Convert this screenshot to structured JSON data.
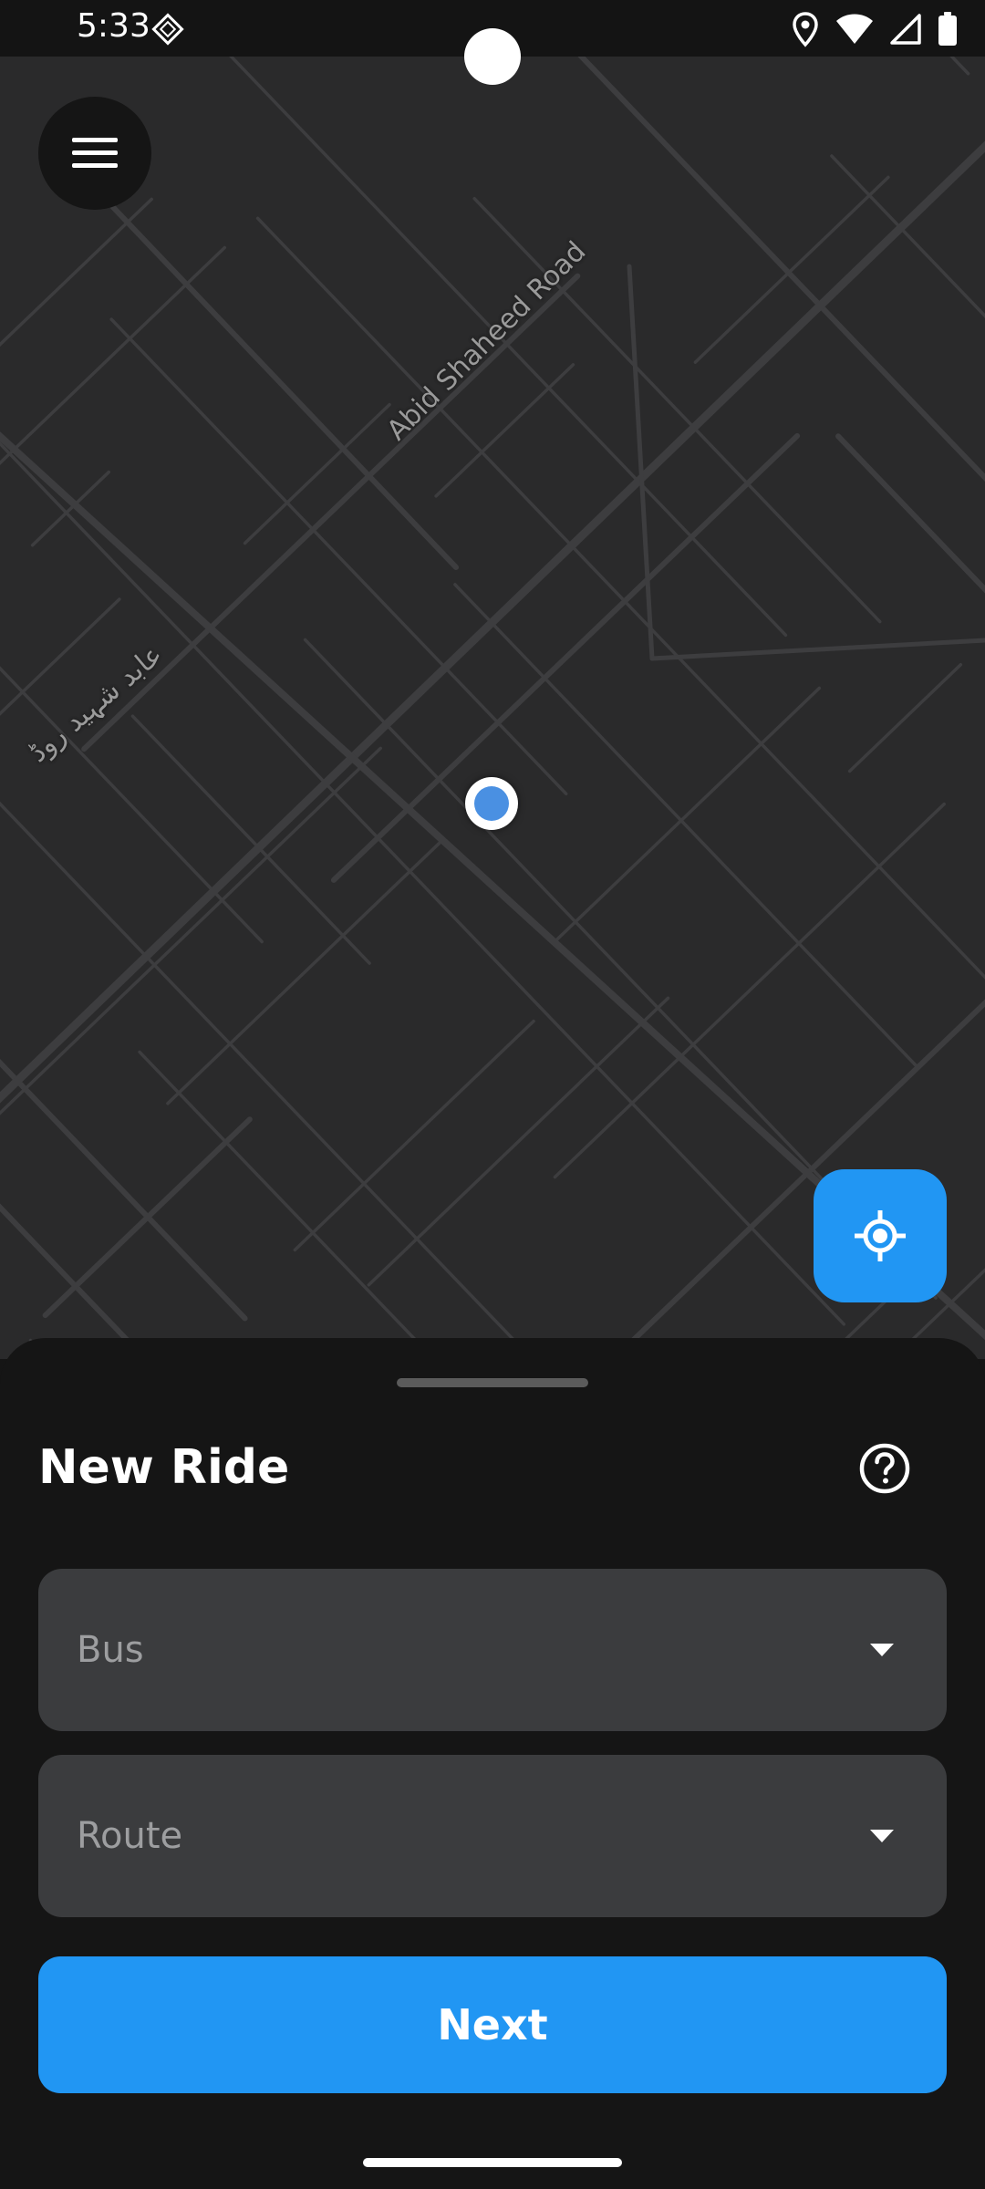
{
  "status_bar": {
    "time": "5:33",
    "icons": [
      "notification-icon",
      "location-icon",
      "wifi-icon",
      "signal-icon",
      "battery-icon"
    ]
  },
  "map": {
    "street_labels": {
      "road_en": "Abid Shaheed Road",
      "road_ur": "عابد شہید روڈ"
    },
    "background_color": "#2a2a2b",
    "street_color": "#3d3d3f",
    "location_marker_color": "#4a90e2"
  },
  "menu_button": {
    "icon": "hamburger-menu-icon"
  },
  "locate_button": {
    "icon": "my-location-icon",
    "color": "#2196f3"
  },
  "sheet": {
    "title": "New Ride",
    "help_icon": "help-circle-icon",
    "bus_dropdown": {
      "placeholder": "Bus",
      "value": ""
    },
    "route_dropdown": {
      "placeholder": "Route",
      "value": ""
    },
    "next_label": "Next",
    "accent_color": "#2196f3"
  }
}
